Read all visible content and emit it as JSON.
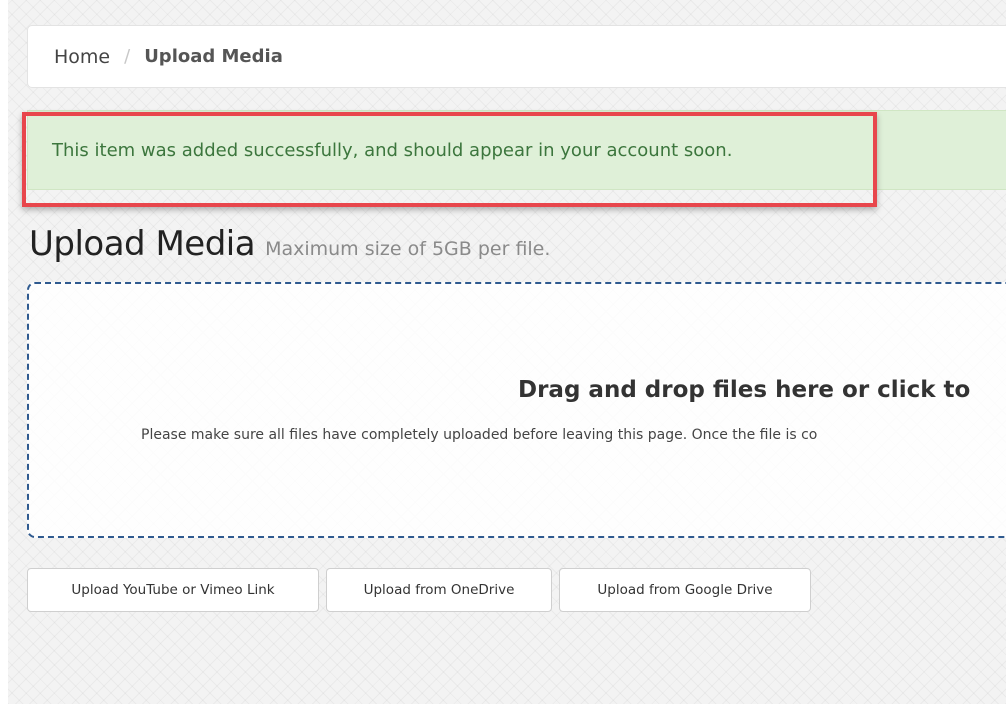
{
  "breadcrumb": {
    "home_label": "Home",
    "separator": "/",
    "current_label": "Upload Media"
  },
  "alert": {
    "message": "This item was added successfully, and should appear in your account soon."
  },
  "heading": {
    "title": "Upload Media",
    "subtitle": "Maximum size of 5GB per file."
  },
  "dropzone": {
    "title": "Drag and drop files here or click to",
    "hint": "Please make sure all files have completely uploaded before leaving this page. Once the file is co"
  },
  "buttons": {
    "youtube_label": "Upload YouTube or Vimeo Link",
    "onedrive_label": "Upload from OneDrive",
    "gdrive_label": "Upload from Google Drive"
  },
  "colors": {
    "alert_bg": "#dff0d8",
    "alert_text": "#3c763d",
    "highlight_border": "#e8464c",
    "dropzone_border": "#2f5a8f"
  }
}
